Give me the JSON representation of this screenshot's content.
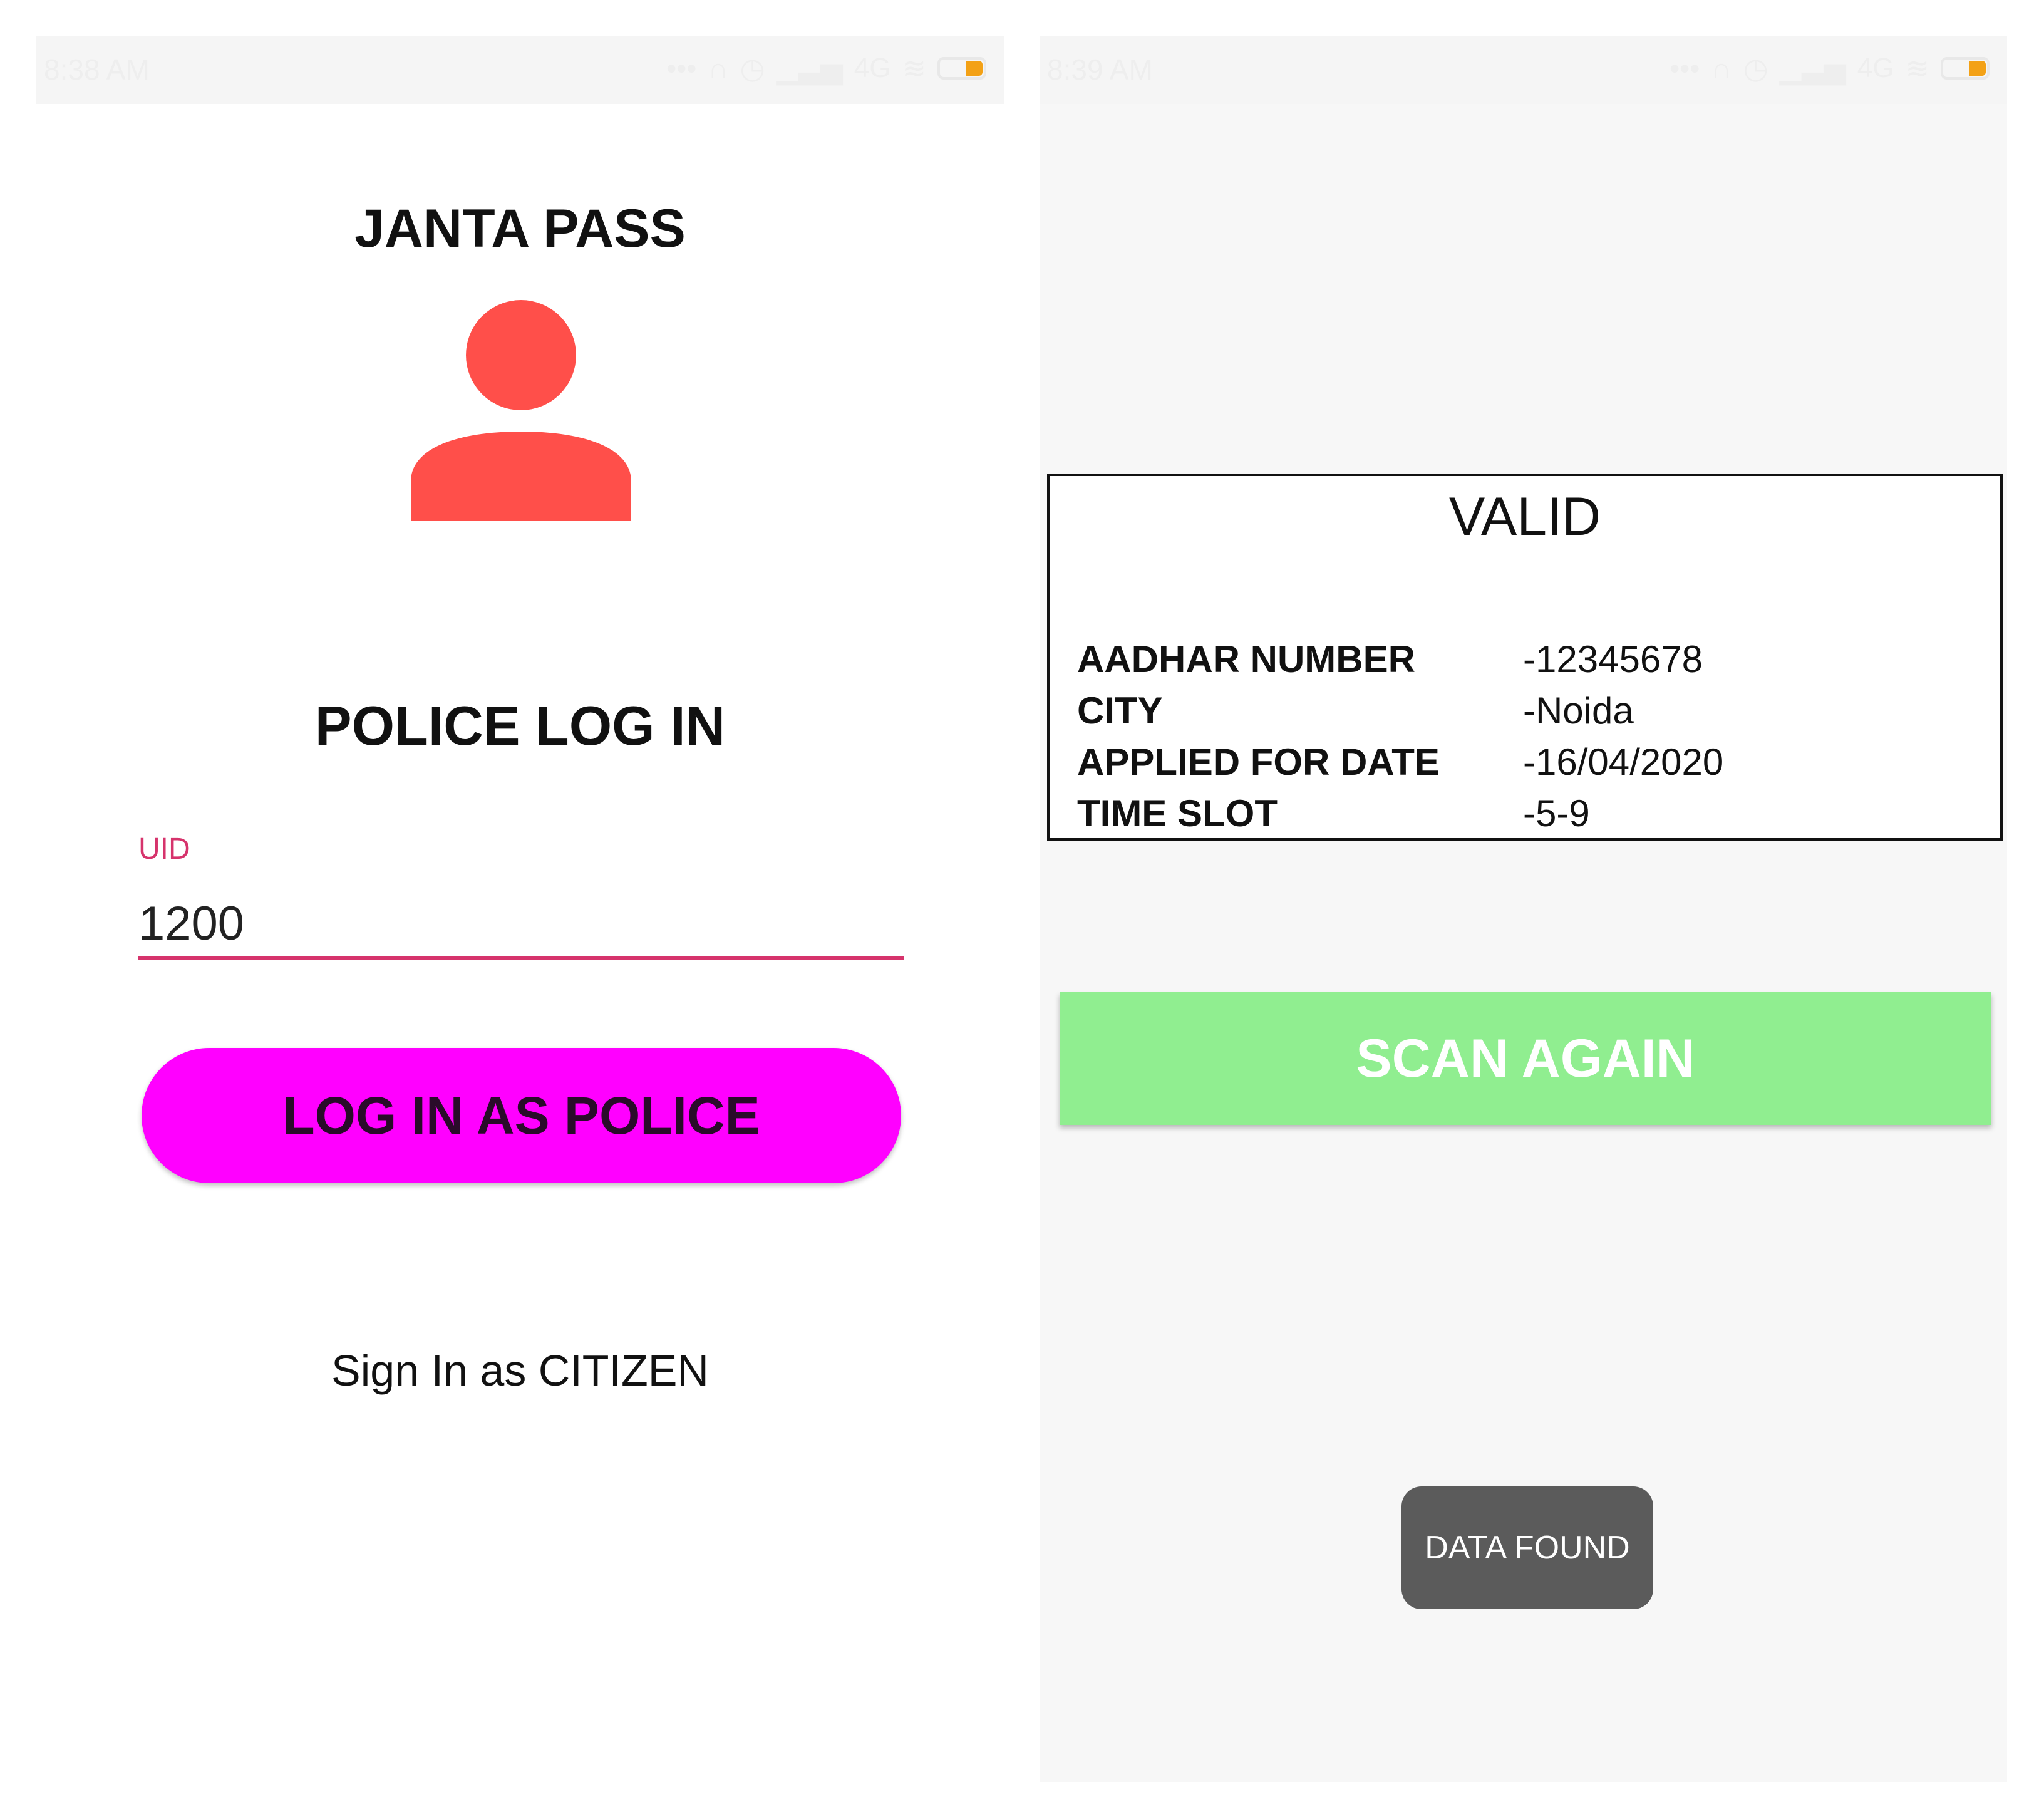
{
  "left_screen": {
    "status_bar": {
      "time": "8:38 AM",
      "network": "4G",
      "battery_color": "#f3a116"
    },
    "app_title": "JANTA PASS",
    "avatar_icon": "user-icon",
    "avatar_color": "#ff4f4a",
    "login_title": "POLICE LOG IN",
    "uid_field": {
      "label": "UID",
      "value": "1200"
    },
    "login_button_label": "LOG IN AS POLICE",
    "login_button_color": "#ff00ff",
    "citizen_link": "Sign In as CITIZEN"
  },
  "right_screen": {
    "status_bar": {
      "time": "8:39 AM",
      "network": "4G",
      "battery_color": "#f3a116"
    },
    "result": {
      "status": "VALID",
      "rows": [
        {
          "label": "AADHAR NUMBER",
          "value": "-12345678"
        },
        {
          "label": "CITY",
          "value": "-Noida"
        },
        {
          "label": "APPLIED FOR DATE",
          "value": "-16/04/2020"
        },
        {
          "label": "TIME SLOT",
          "value": "-5-9"
        }
      ]
    },
    "scan_button_label": "SCAN AGAIN",
    "scan_button_color": "#90ee90",
    "toast": "DATA FOUND"
  }
}
